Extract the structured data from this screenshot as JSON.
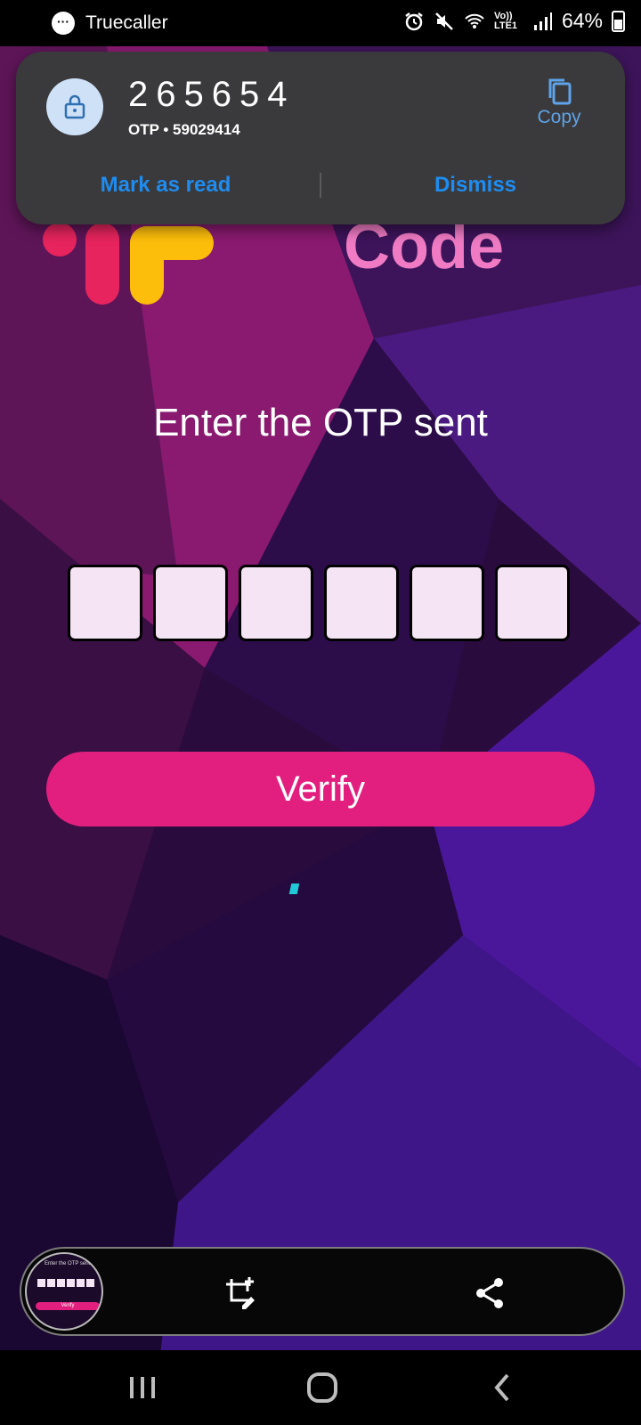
{
  "status_bar": {
    "app_name": "Truecaller",
    "app_icon": "chat-bubble-icon",
    "network_label": "Vo)) LTE1",
    "battery": "64%"
  },
  "notification": {
    "otp_code": "265654",
    "subtitle": "OTP • 59029414",
    "copy_label": "Copy",
    "mark_read_label": "Mark as read",
    "dismiss_label": "Dismiss"
  },
  "app": {
    "logo_text": "Code",
    "prompt": "Enter the OTP sent",
    "otp_boxes": [
      "",
      "",
      "",
      "",
      "",
      ""
    ],
    "verify_label": "Verify",
    "colors": {
      "accent": "#e21f7f",
      "logo_text": "#f07bc4",
      "otp_box": "#f5e4f4",
      "logo_red": "#e8245e",
      "logo_yellow": "#fdbe0b"
    }
  },
  "screenshot_toolbar": {
    "thumb_prompt": "Enter the OTP sent",
    "thumb_verify": "Verify",
    "actions": [
      "crop-edit-icon",
      "share-icon"
    ]
  },
  "nav_bar": {
    "buttons": [
      "recents-icon",
      "home-icon",
      "back-icon"
    ]
  }
}
